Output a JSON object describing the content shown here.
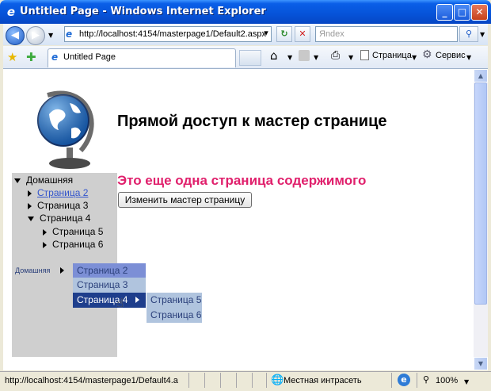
{
  "window": {
    "title": "Untitled Page - Windows Internet Explorer",
    "minimize": "_",
    "maximize": "□",
    "close": "✕"
  },
  "navbar": {
    "address": "http://localhost:4154/masterpage1/Default2.aspx",
    "search_placeholder": "Яndex",
    "refresh_symbol": "↻",
    "stop_symbol": "✕",
    "go_symbol": "▾"
  },
  "favbar": {
    "tab_title": "Untitled Page",
    "page_menu": "Страница",
    "tools_menu": "Сервис"
  },
  "page": {
    "heading": "Прямой доступ к мастер странице",
    "content_title": "Это еще одна страница содержимого",
    "change_button": "Изменить мастер страницу"
  },
  "tree": [
    {
      "label": "Домашняя",
      "level": 0,
      "state": "expanded",
      "link": false
    },
    {
      "label": "Страница 2",
      "level": 1,
      "state": "collapsed",
      "link": true
    },
    {
      "label": "Страница 3",
      "level": 1,
      "state": "collapsed",
      "link": false
    },
    {
      "label": "Страница 4",
      "level": 1,
      "state": "expanded",
      "link": false
    },
    {
      "label": "Страница 5",
      "level": 2,
      "state": "collapsed",
      "link": false
    },
    {
      "label": "Страница 6",
      "level": 2,
      "state": "collapsed",
      "link": false
    }
  ],
  "menu": {
    "root": "Домашняя",
    "level1": [
      "Страница 2",
      "Страница 3",
      "Страница 4"
    ],
    "level2": [
      "Страница 5",
      "Страница 6"
    ]
  },
  "status": {
    "url": "http://localhost:4154/masterpage1/Default4.a",
    "zone": "Местная интрасеть",
    "zoom": "100%"
  },
  "colors": {
    "accent": "#0653D8",
    "content_title": "#E0206C",
    "menu_level1": "#7C8FD6",
    "menu_active": "#1E3E8C",
    "menu_level2": "#B0C4DE"
  }
}
